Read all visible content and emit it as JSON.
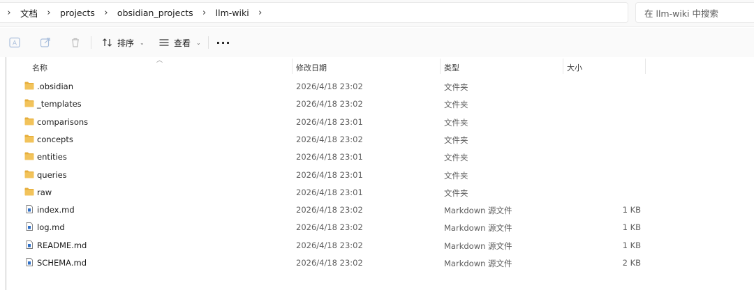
{
  "breadcrumb": {
    "leading_chevron": "›",
    "items": [
      "文档",
      "projects",
      "obsidian_projects",
      "llm-wiki"
    ],
    "trailing_chevron": "›"
  },
  "search": {
    "placeholder": "在 llm-wiki 中搜索"
  },
  "toolbar": {
    "sort_label": "排序",
    "view_label": "查看",
    "more_label": "···",
    "icons": [
      "rename-icon",
      "share-icon",
      "delete-icon",
      "sort-icon",
      "view-icon",
      "more-icon"
    ]
  },
  "columns": {
    "name": "名称",
    "date": "修改日期",
    "type": "类型",
    "size": "大小"
  },
  "files": [
    {
      "name": ".obsidian",
      "date": "2026/4/18 23:02",
      "type": "文件夹",
      "size": "",
      "kind": "folder"
    },
    {
      "name": "_templates",
      "date": "2026/4/18 23:02",
      "type": "文件夹",
      "size": "",
      "kind": "folder"
    },
    {
      "name": "comparisons",
      "date": "2026/4/18 23:01",
      "type": "文件夹",
      "size": "",
      "kind": "folder"
    },
    {
      "name": "concepts",
      "date": "2026/4/18 23:02",
      "type": "文件夹",
      "size": "",
      "kind": "folder"
    },
    {
      "name": "entities",
      "date": "2026/4/18 23:01",
      "type": "文件夹",
      "size": "",
      "kind": "folder"
    },
    {
      "name": "queries",
      "date": "2026/4/18 23:01",
      "type": "文件夹",
      "size": "",
      "kind": "folder"
    },
    {
      "name": "raw",
      "date": "2026/4/18 23:01",
      "type": "文件夹",
      "size": "",
      "kind": "folder"
    },
    {
      "name": "index.md",
      "date": "2026/4/18 23:02",
      "type": "Markdown 源文件",
      "size": "1 KB",
      "kind": "file"
    },
    {
      "name": "log.md",
      "date": "2026/4/18 23:02",
      "type": "Markdown 源文件",
      "size": "1 KB",
      "kind": "file"
    },
    {
      "name": "README.md",
      "date": "2026/4/18 23:02",
      "type": "Markdown 源文件",
      "size": "1 KB",
      "kind": "file"
    },
    {
      "name": "SCHEMA.md",
      "date": "2026/4/18 23:02",
      "type": "Markdown 源文件",
      "size": "2 KB",
      "kind": "file"
    }
  ],
  "colors": {
    "folder": "#f2c35b",
    "folder_tab": "#e6ad3a",
    "file_icon_accent": "#2f6fc6"
  }
}
